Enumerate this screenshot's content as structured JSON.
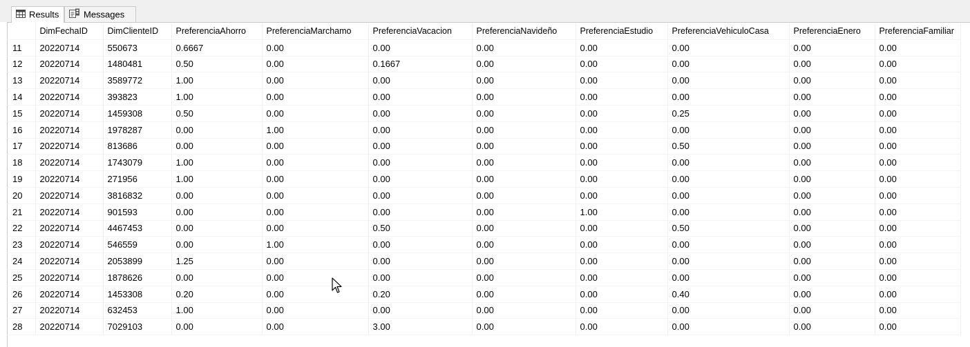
{
  "tabs": [
    {
      "label": "Results",
      "icon": "grid-icon"
    },
    {
      "label": "Messages",
      "icon": "messages-icon"
    }
  ],
  "grid": {
    "columns": [
      "",
      "DimFechaID",
      "DimClienteID",
      "PreferenciaAhorro",
      "PreferenciaMarchamo",
      "PreferenciaVacacion",
      "PreferenciaNavideño",
      "PreferenciaEstudio",
      "PreferenciaVehiculoCasa",
      "PreferenciaEnero",
      "PreferenciaFamiliar"
    ],
    "rows": [
      [
        "11",
        "20220714",
        "550673",
        "0.6667",
        "0.00",
        "0.00",
        "0.00",
        "0.00",
        "0.00",
        "0.00",
        "0.00"
      ],
      [
        "12",
        "20220714",
        "1480481",
        "0.50",
        "0.00",
        "0.1667",
        "0.00",
        "0.00",
        "0.00",
        "0.00",
        "0.00"
      ],
      [
        "13",
        "20220714",
        "3589772",
        "1.00",
        "0.00",
        "0.00",
        "0.00",
        "0.00",
        "0.00",
        "0.00",
        "0.00"
      ],
      [
        "14",
        "20220714",
        "393823",
        "1.00",
        "0.00",
        "0.00",
        "0.00",
        "0.00",
        "0.00",
        "0.00",
        "0.00"
      ],
      [
        "15",
        "20220714",
        "1459308",
        "0.50",
        "0.00",
        "0.00",
        "0.00",
        "0.00",
        "0.25",
        "0.00",
        "0.00"
      ],
      [
        "16",
        "20220714",
        "1978287",
        "0.00",
        "1.00",
        "0.00",
        "0.00",
        "0.00",
        "0.00",
        "0.00",
        "0.00"
      ],
      [
        "17",
        "20220714",
        "813686",
        "0.00",
        "0.00",
        "0.00",
        "0.00",
        "0.00",
        "0.50",
        "0.00",
        "0.00"
      ],
      [
        "18",
        "20220714",
        "1743079",
        "1.00",
        "0.00",
        "0.00",
        "0.00",
        "0.00",
        "0.00",
        "0.00",
        "0.00"
      ],
      [
        "19",
        "20220714",
        "271956",
        "1.00",
        "0.00",
        "0.00",
        "0.00",
        "0.00",
        "0.00",
        "0.00",
        "0.00"
      ],
      [
        "20",
        "20220714",
        "3816832",
        "0.00",
        "0.00",
        "0.00",
        "0.00",
        "0.00",
        "0.00",
        "0.00",
        "0.00"
      ],
      [
        "21",
        "20220714",
        "901593",
        "0.00",
        "0.00",
        "0.00",
        "0.00",
        "1.00",
        "0.00",
        "0.00",
        "0.00"
      ],
      [
        "22",
        "20220714",
        "4467453",
        "0.00",
        "0.00",
        "0.50",
        "0.00",
        "0.00",
        "0.50",
        "0.00",
        "0.00"
      ],
      [
        "23",
        "20220714",
        "546559",
        "0.00",
        "1.00",
        "0.00",
        "0.00",
        "0.00",
        "0.00",
        "0.00",
        "0.00"
      ],
      [
        "24",
        "20220714",
        "2053899",
        "1.25",
        "0.00",
        "0.00",
        "0.00",
        "0.00",
        "0.00",
        "0.00",
        "0.00"
      ],
      [
        "25",
        "20220714",
        "1878626",
        "0.00",
        "0.00",
        "0.00",
        "0.00",
        "0.00",
        "0.00",
        "0.00",
        "0.00"
      ],
      [
        "26",
        "20220714",
        "1453308",
        "0.20",
        "0.00",
        "0.20",
        "0.00",
        "0.00",
        "0.40",
        "0.00",
        "0.00"
      ],
      [
        "27",
        "20220714",
        "632453",
        "1.00",
        "0.00",
        "0.00",
        "0.00",
        "0.00",
        "0.00",
        "0.00",
        "0.00"
      ],
      [
        "28",
        "20220714",
        "7029103",
        "0.00",
        "0.00",
        "3.00",
        "0.00",
        "0.00",
        "0.00",
        "0.00",
        "0.00"
      ]
    ]
  },
  "cursor_icon": "mouse-pointer-icon"
}
